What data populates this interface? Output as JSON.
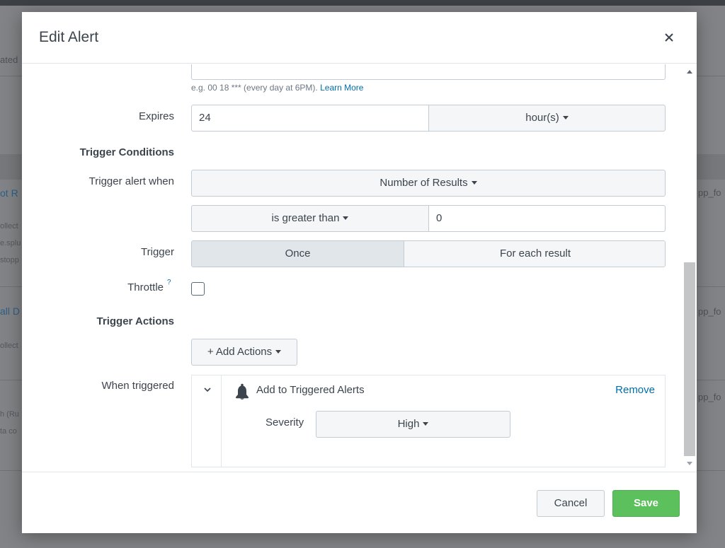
{
  "background": {
    "fragments": [
      "ated",
      "ot R",
      "ollect",
      "e.splu",
      "stopp",
      "all D",
      "ollect",
      "h (Ru",
      "ta co",
      "pp_fo",
      "pp_fo",
      "pp_fo"
    ]
  },
  "modal": {
    "title": "Edit Alert",
    "close_icon": "close-icon"
  },
  "schedule": {
    "help_text": "e.g. 00 18 *** (every day at 6PM). ",
    "learn_more": "Learn More"
  },
  "expires": {
    "label": "Expires",
    "value": "24",
    "unit": "hour(s)"
  },
  "trigger_conditions": {
    "heading": "Trigger Conditions",
    "when_label": "Trigger alert when",
    "when_value": "Number of Results",
    "comparator": "is greater than",
    "threshold": "0"
  },
  "trigger": {
    "label": "Trigger",
    "options": [
      "Once",
      "For each result"
    ],
    "selected": "Once"
  },
  "throttle": {
    "label": "Throttle",
    "help_mark": "?",
    "checked": false
  },
  "trigger_actions": {
    "heading": "Trigger Actions",
    "add_button": "+ Add Actions",
    "when_triggered_label": "When triggered",
    "action": {
      "title": "Add to Triggered Alerts",
      "remove": "Remove",
      "severity_label": "Severity",
      "severity_value": "High"
    }
  },
  "footer": {
    "cancel": "Cancel",
    "save": "Save"
  },
  "colors": {
    "link": "#006eaa",
    "save": "#5cc05c",
    "border": "#c3cbd4"
  }
}
